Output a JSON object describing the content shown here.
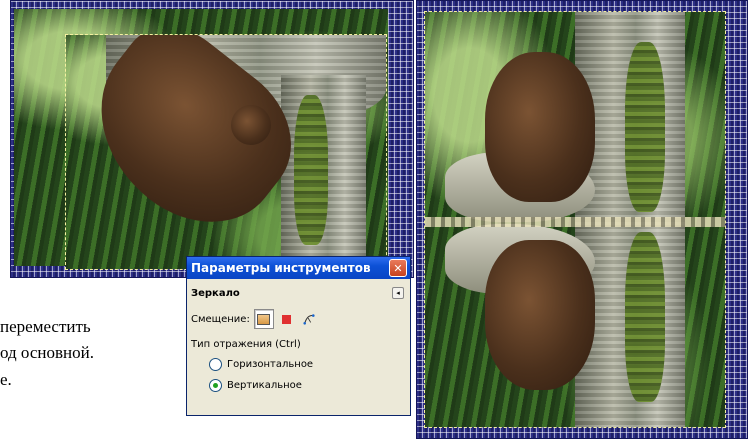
{
  "dialog": {
    "title": "Параметры инструментов",
    "close_glyph": "✕",
    "tool_name": "Зеркало",
    "collapse_glyph": "◂",
    "offset_label": "Смещение:",
    "offset_modes": [
      "layer-icon",
      "selection-icon",
      "path-icon"
    ],
    "reflection_label": "Тип отражения  (Ctrl)",
    "options": [
      {
        "label": "Горизонтальное",
        "checked": false
      },
      {
        "label": "Вертикальное",
        "checked": true
      }
    ]
  },
  "page_text": {
    "line1": "переместить",
    "line2": "од основной.",
    "line3": "е."
  },
  "colors": {
    "frame": "#2d2f86",
    "titlebar": "#0d51d6",
    "dialog_bg": "#ece9d8",
    "radio_checked": "#21a121"
  }
}
